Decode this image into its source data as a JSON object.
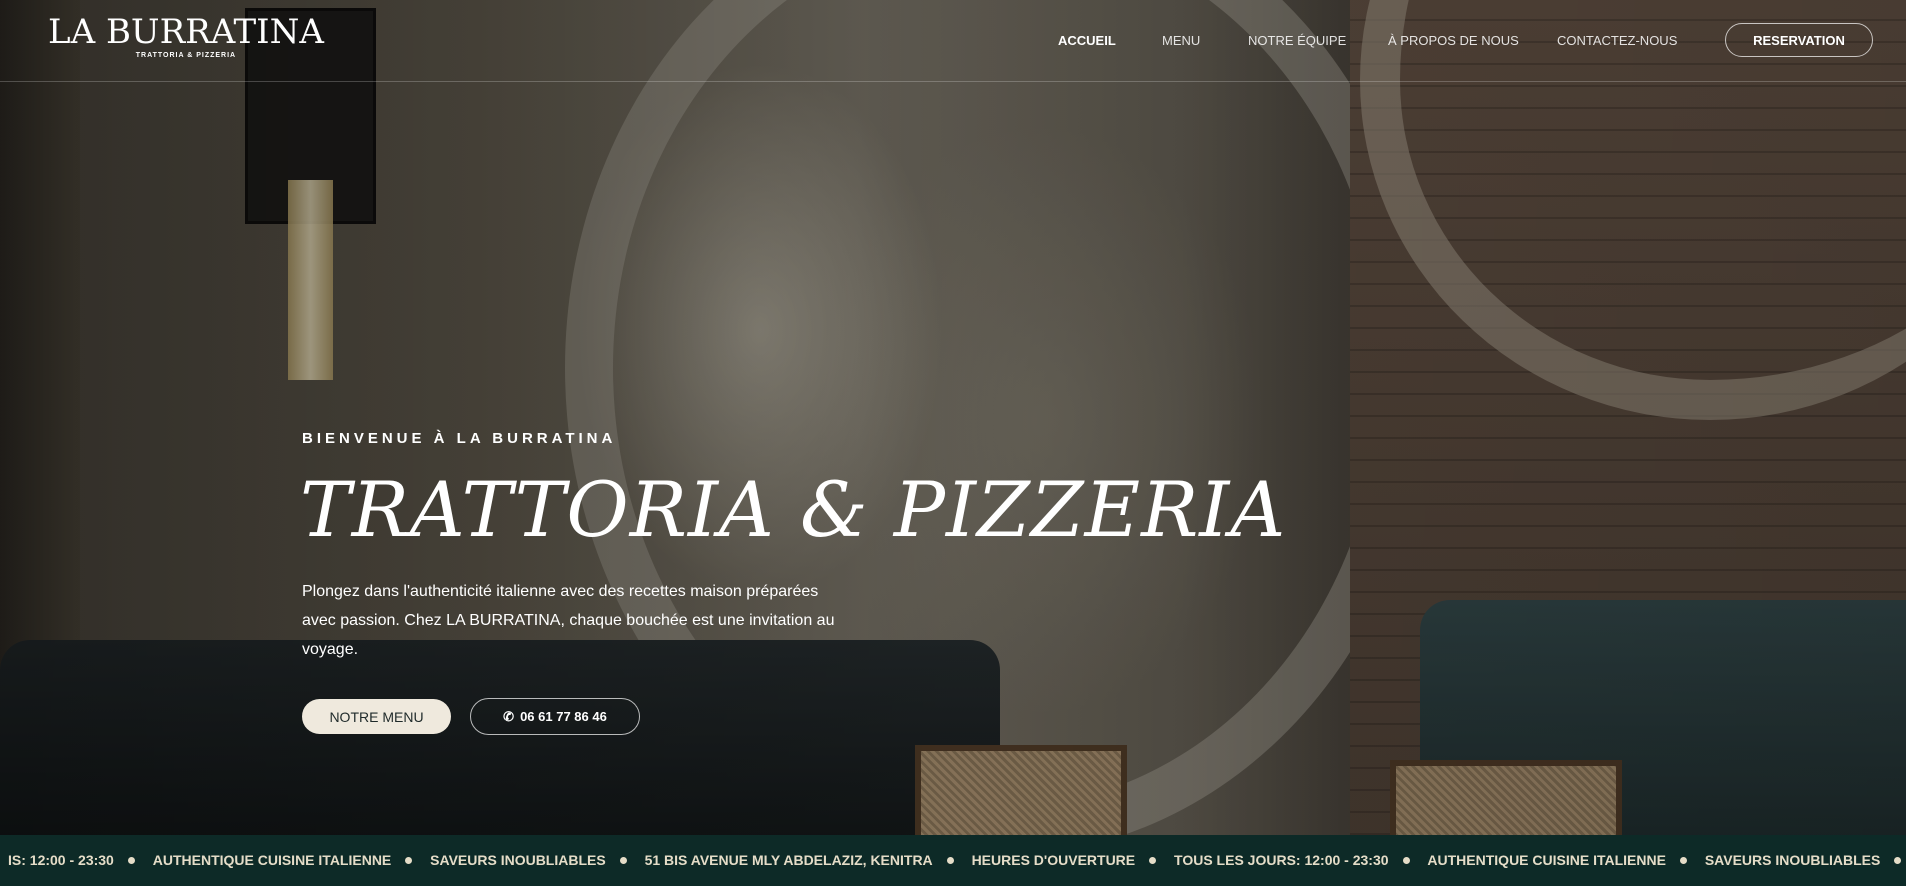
{
  "brand": {
    "name": "LA BURRATINA",
    "tagline": "TRATTORIA & PIZZERIA"
  },
  "nav": {
    "items": [
      {
        "label": "ACCUEIL",
        "active": true
      },
      {
        "label": "MENU"
      },
      {
        "label": "NOTRE ÉQUIPE"
      },
      {
        "label": "À PROPOS DE NOUS"
      },
      {
        "label": "CONTACTEZ-NOUS"
      }
    ],
    "reserve_label": "RESERVATION"
  },
  "hero": {
    "eyebrow": "BIENVENUE À LA BURRATINA",
    "title": "TRATTORIA & PIZZERIA",
    "description": "Plongez dans l'authenticité italienne avec des recettes maison préparées avec passion. Chez LA BURRATINA, chaque bouchée est une invitation au voyage.",
    "menu_button": "NOTRE MENU",
    "phone_button": "06 61 77 86 46",
    "phone_icon": "phone-icon"
  },
  "ticker": {
    "items": [
      "IS: 12:00 - 23:30",
      "AUTHENTIQUE CUISINE ITALIENNE",
      "SAVEURS INOUBLIABLES",
      "51 BIS AVENUE MLY ABDELAZIZ, KENITRA",
      "HEURES D'OUVERTURE",
      "TOUS LES JOURS: 12:00 - 23:30",
      "AUTHENTIQUE CUISINE ITALIENNE",
      "SAVEURS INOUBLIABLES"
    ]
  },
  "colors": {
    "ticker_bg": "#0d2a27",
    "ticker_text": "#e5ddc8",
    "button_light": "#efe9dd"
  }
}
